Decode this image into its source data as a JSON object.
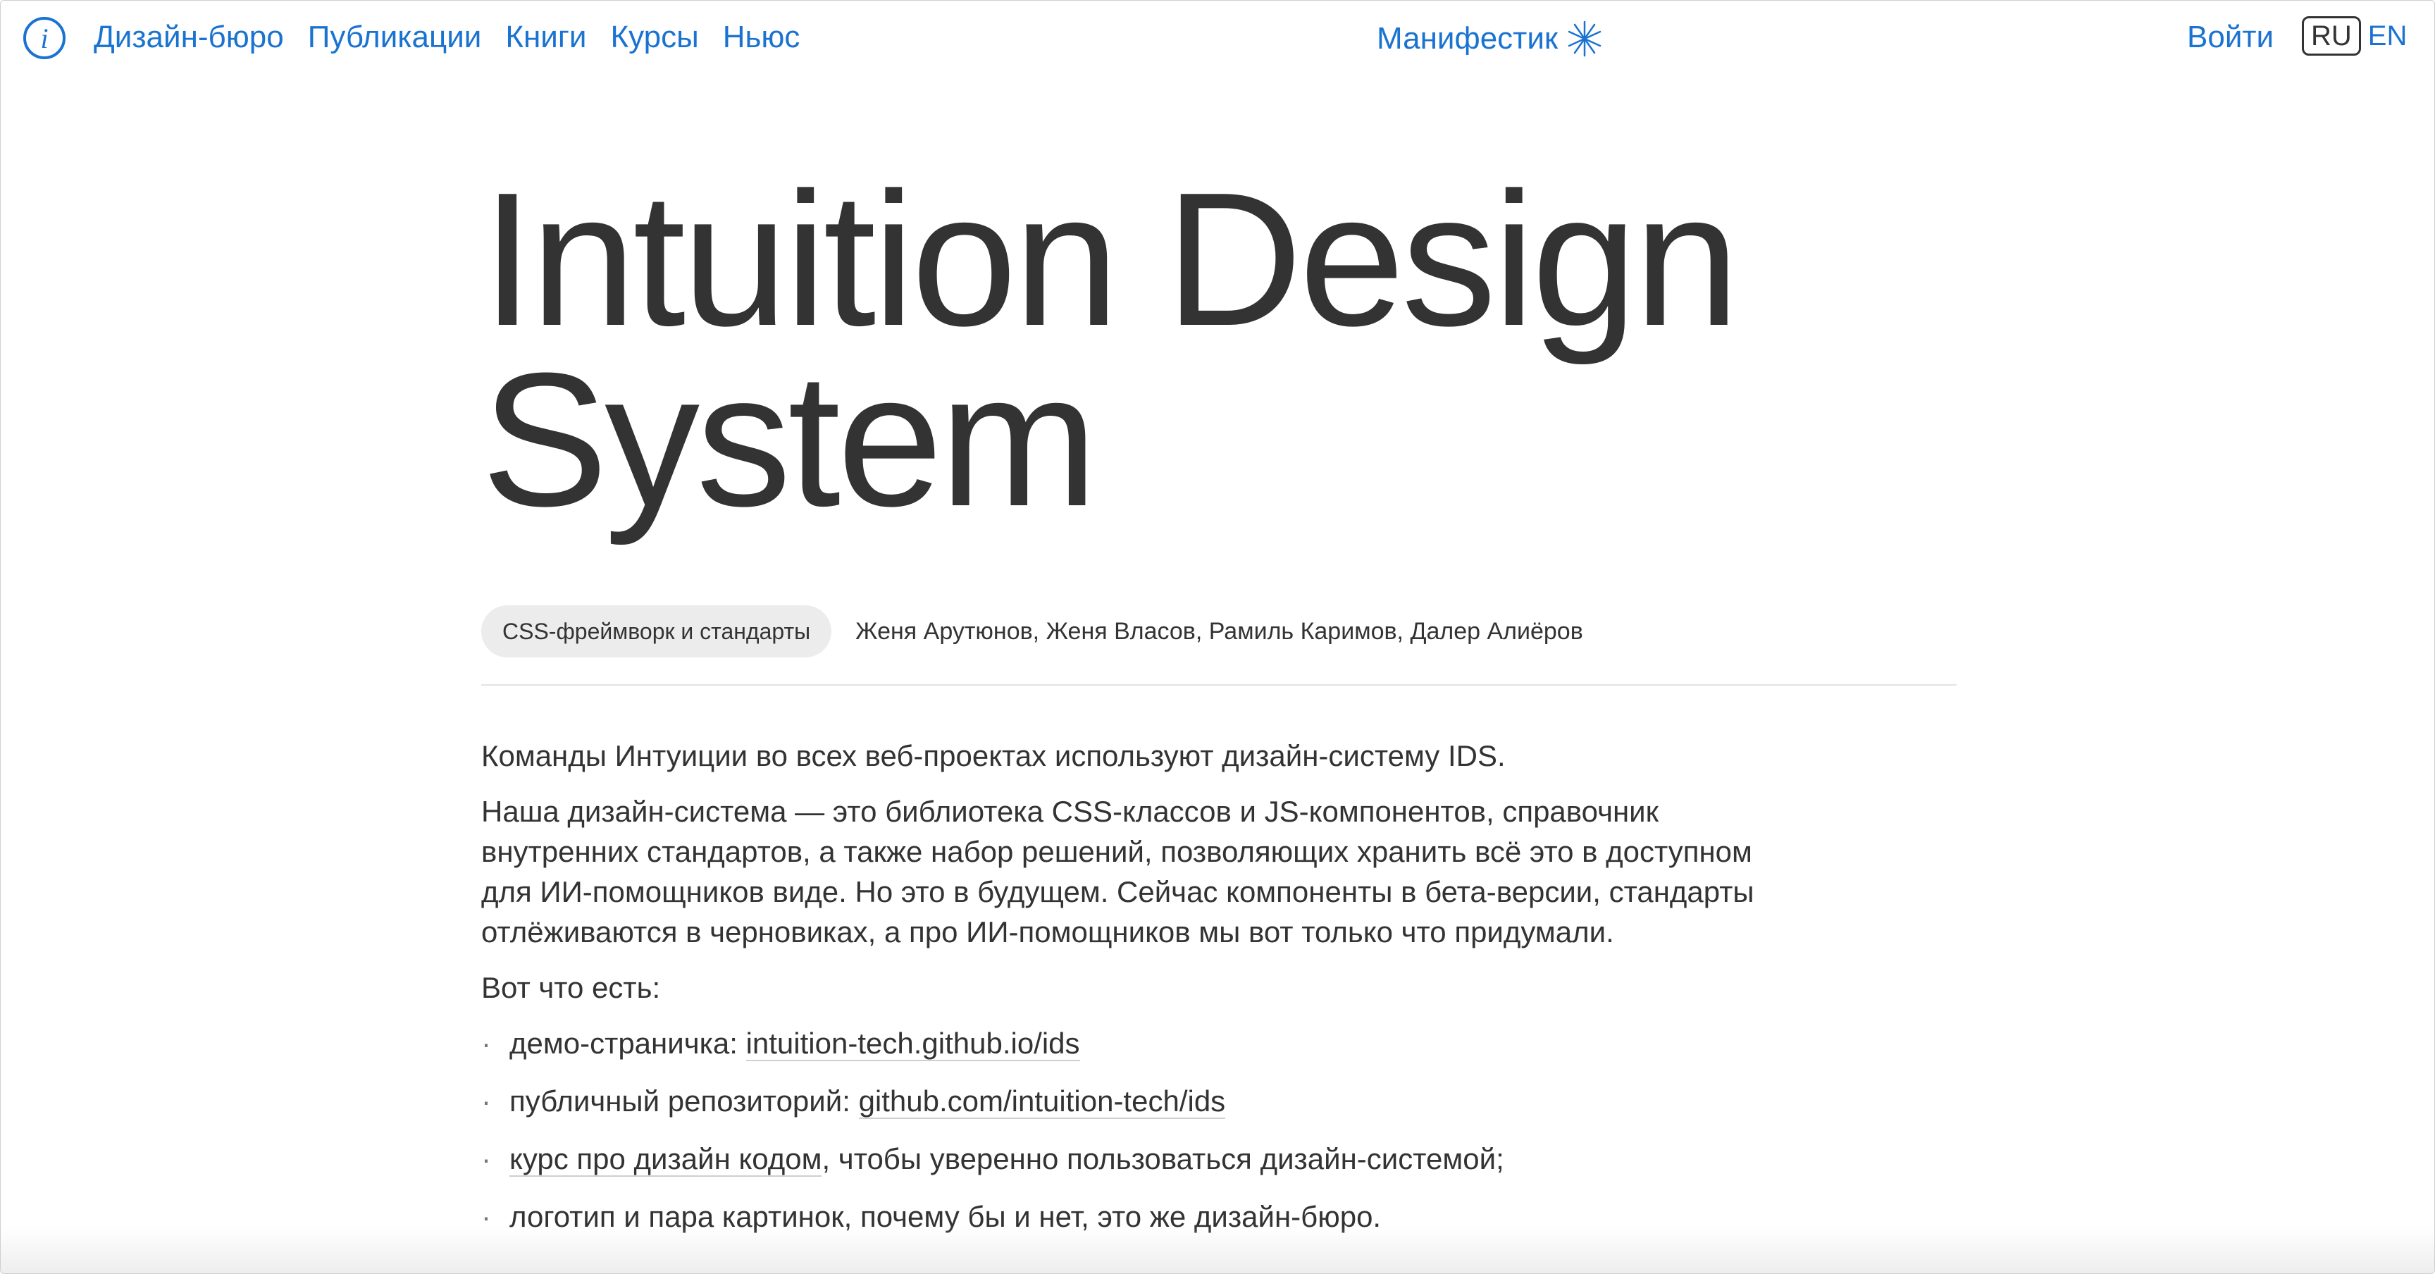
{
  "header": {
    "logo_letter": "i",
    "nav": [
      "Дизайн-бюро",
      "Публикации",
      "Книги",
      "Курсы",
      "Ньюс"
    ],
    "manifest_label": "Манифестик",
    "login_label": "Войти",
    "lang_active": "RU",
    "lang_other": "EN"
  },
  "colors": {
    "link": "#1a73d1",
    "text": "#333333",
    "tag_bg": "#ececec"
  },
  "page": {
    "title_line1": "Intuition Design",
    "title_line2": "System",
    "tag": "CSS-фреймворк и стандарты",
    "authors": "Женя Арутюнов, Женя Власов, Рамиль Каримов, Далер Алиёров"
  },
  "content": {
    "p1": "Команды Интуиции во всех веб-проектах используют дизайн-систему IDS.",
    "p2": "Наша дизайн-система — это библиотека CSS-классов и JS-компонентов, справочник внутренних стандартов, а также набор решений, позволяющих хранить всё это в доступном для ИИ-помощников виде. Но это в будущем. Сейчас компоненты в бета-версии, стандарты отлёживаются в черновиках, а про ИИ-помощников мы вот только что придумали.",
    "p3": "Вот что есть:",
    "bullet": "·",
    "items": [
      {
        "prefix": "демо-страничка: ",
        "link": "intuition-tech.github.io/ids",
        "suffix": ""
      },
      {
        "prefix": "публичный репозиторий: ",
        "link": "github.com/intuition-tech/ids",
        "suffix": ""
      },
      {
        "prefix": "",
        "link": "курс про дизайн кодом",
        "suffix": ", чтобы уверенно пользоваться дизайн-системой;"
      },
      {
        "prefix": "логотип и пара картинок, почему бы и нет, это же дизайн-бюро.",
        "link": "",
        "suffix": ""
      }
    ]
  }
}
